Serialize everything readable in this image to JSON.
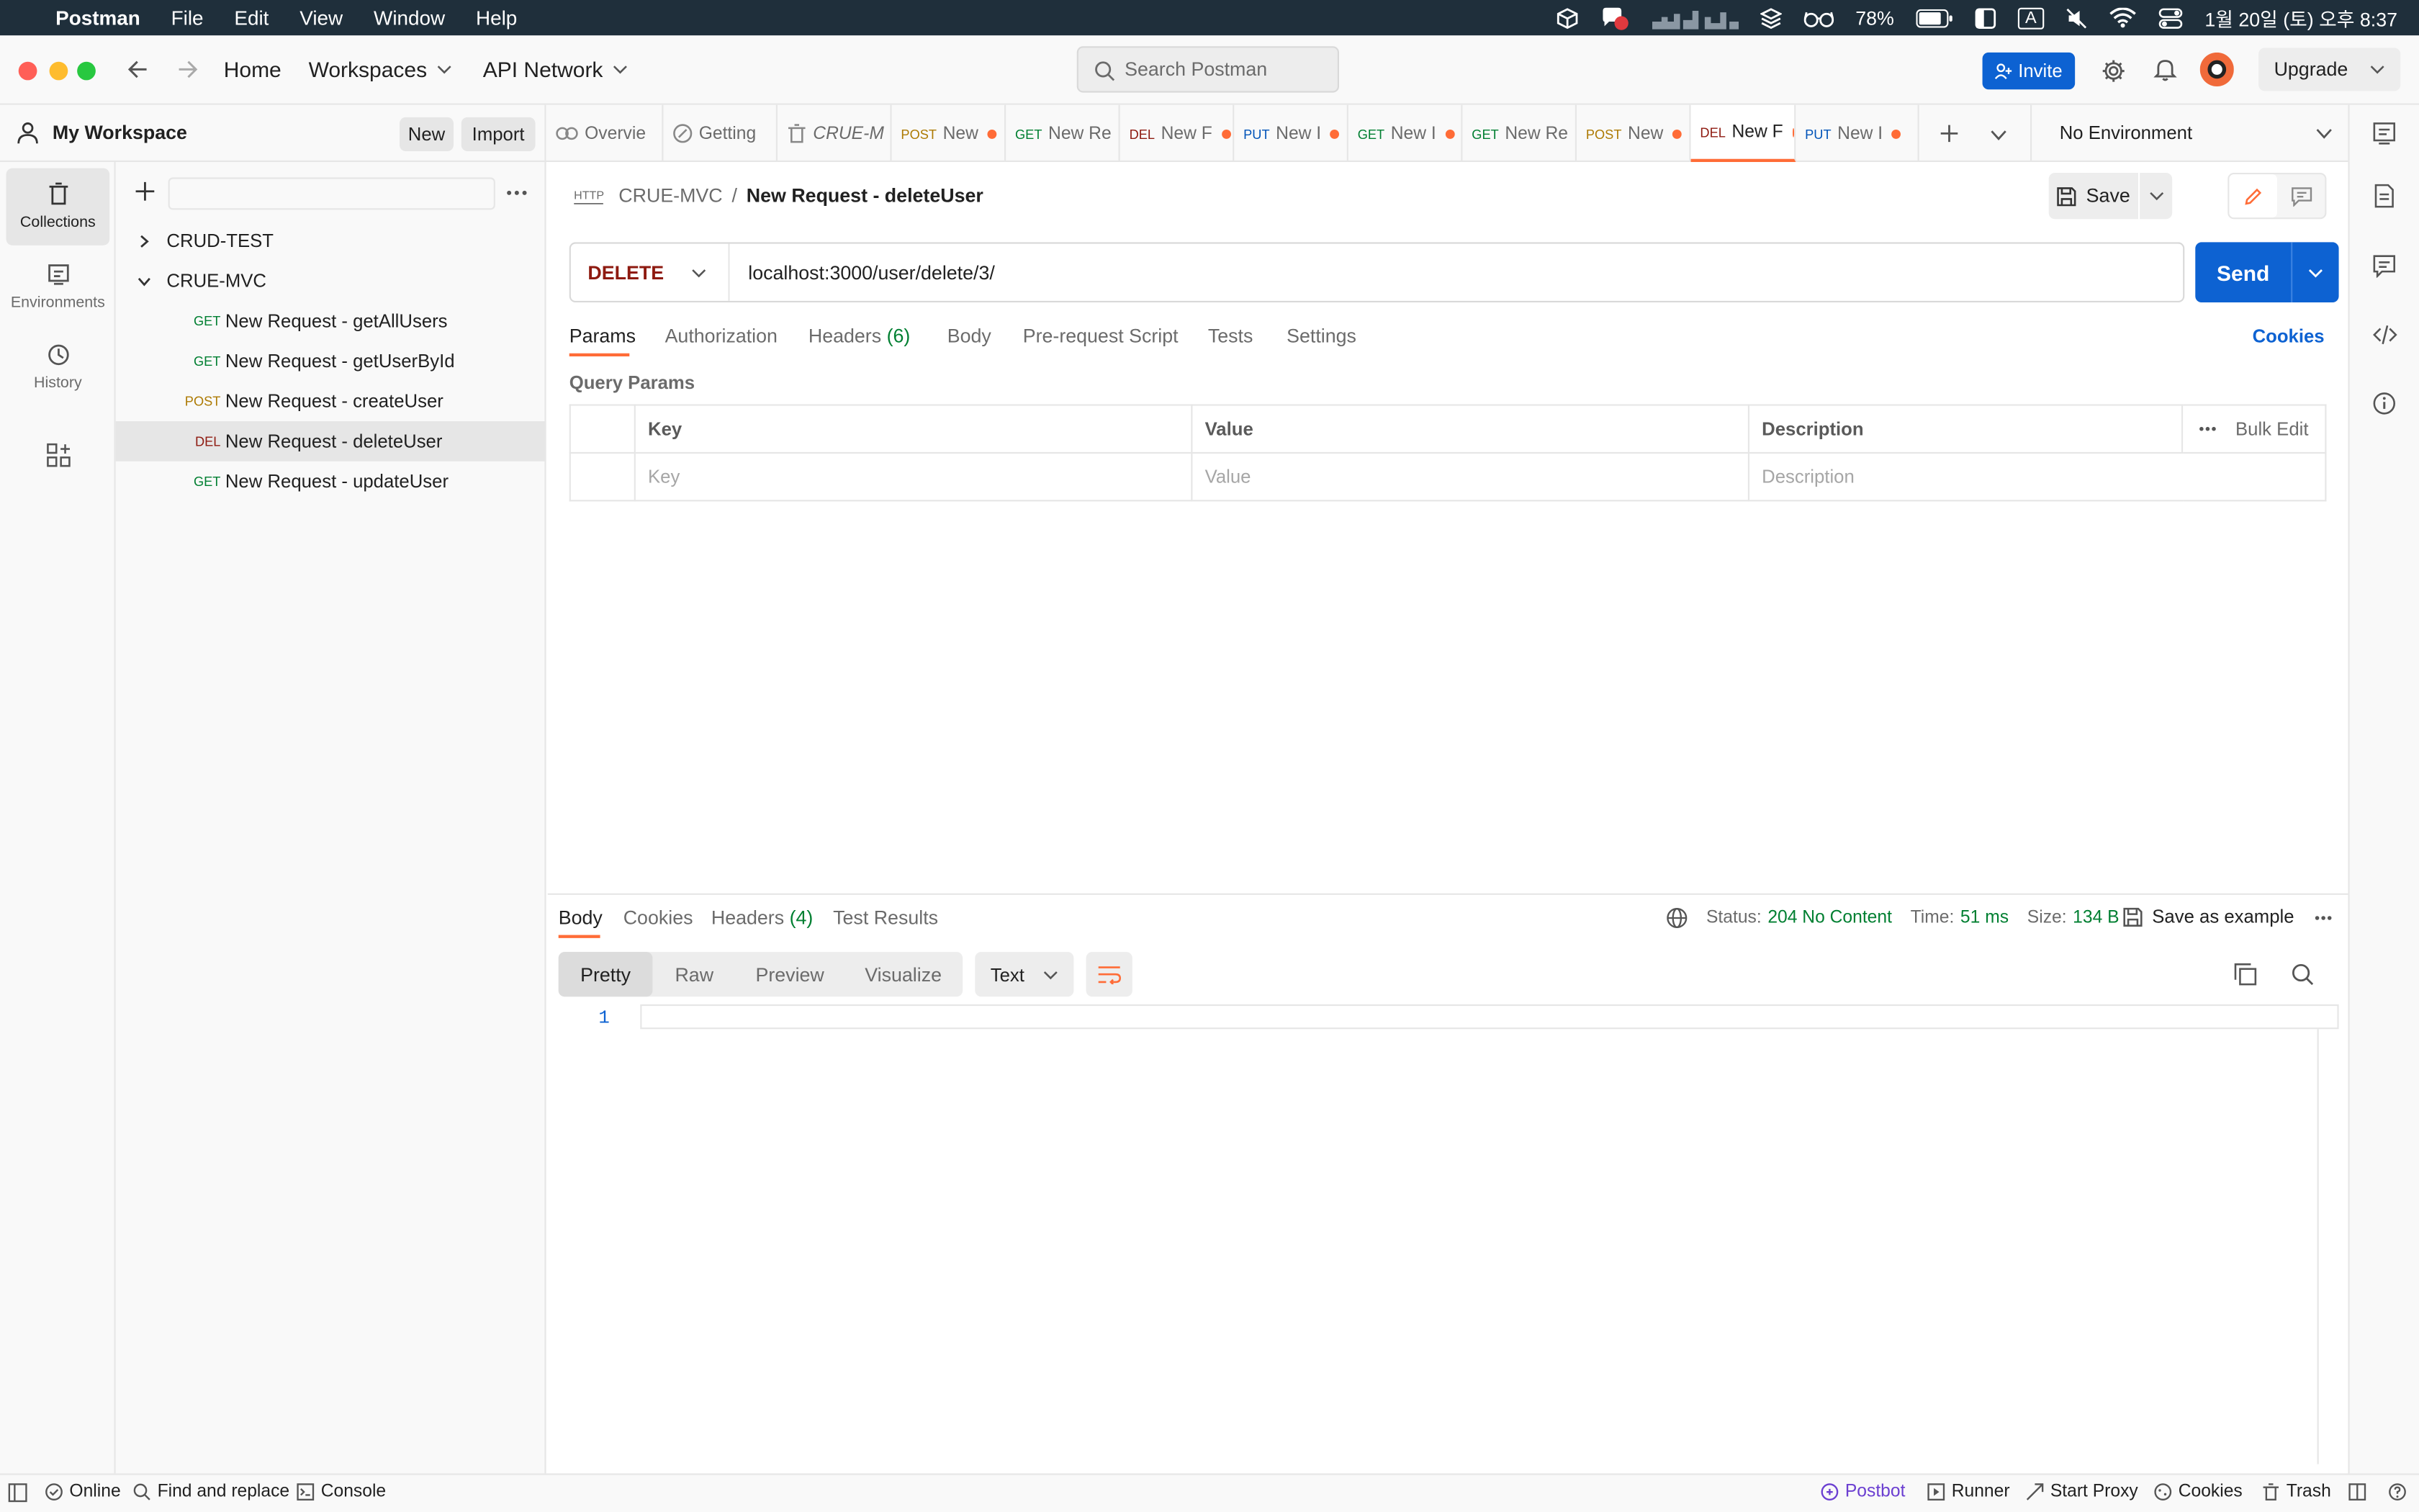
{
  "menubar": {
    "app": "Postman",
    "menus": [
      "File",
      "Edit",
      "View",
      "Window",
      "Help"
    ],
    "battery": "78%",
    "input_mode": "A",
    "datetime": "1월 20일 (토) 오후 8:37"
  },
  "titlebar": {
    "home": "Home",
    "workspaces": "Workspaces",
    "api_network": "API Network",
    "search_placeholder": "Search Postman",
    "invite": "Invite",
    "upgrade": "Upgrade"
  },
  "workspace": {
    "name": "My Workspace",
    "new_label": "New",
    "import_label": "Import"
  },
  "rail": {
    "collections": "Collections",
    "environments": "Environments",
    "history": "History"
  },
  "tree": {
    "collections": [
      {
        "name": "CRUD-TEST",
        "expanded": false
      },
      {
        "name": "CRUE-MVC",
        "expanded": true
      }
    ],
    "requests": [
      {
        "method": "GET",
        "name": "New Request - getAllUsers",
        "color": "#007f31"
      },
      {
        "method": "GET",
        "name": "New Request - getUserById",
        "color": "#007f31"
      },
      {
        "method": "POST",
        "name": "New Request - createUser",
        "color": "#ad7a03"
      },
      {
        "method": "DEL",
        "name": "New Request - deleteUser",
        "color": "#8e1a10"
      },
      {
        "method": "GET",
        "name": "New Request - updateUser",
        "color": "#007f31"
      }
    ]
  },
  "tabs": [
    {
      "method": "",
      "label": "Overvie",
      "dot": false
    },
    {
      "method": "",
      "label": "Getting",
      "dot": false
    },
    {
      "method": "",
      "label": "CRUE-M",
      "dot": false
    },
    {
      "method": "POST",
      "label": "New",
      "dot": true,
      "color": "#ad7a03"
    },
    {
      "method": "GET",
      "label": "New Re",
      "dot": false,
      "color": "#007f31"
    },
    {
      "method": "DEL",
      "label": "New F",
      "dot": true,
      "color": "#8e1a10"
    },
    {
      "method": "PUT",
      "label": "New I",
      "dot": true,
      "color": "#0053b8"
    },
    {
      "method": "GET",
      "label": "New I",
      "dot": true,
      "color": "#007f31"
    },
    {
      "method": "GET",
      "label": "New Re",
      "dot": false,
      "color": "#007f31"
    },
    {
      "method": "POST",
      "label": "New",
      "dot": true,
      "color": "#ad7a03"
    },
    {
      "method": "DEL",
      "label": "New F",
      "dot": true,
      "color": "#8e1a10",
      "active": true
    },
    {
      "method": "PUT",
      "label": "New I",
      "dot": true,
      "color": "#0053b8"
    }
  ],
  "environment": "No Environment",
  "request": {
    "breadcrumb_collection": "CRUE-MVC",
    "breadcrumb_sep": "/",
    "title": "New Request - deleteUser",
    "save": "Save",
    "method": "DELETE",
    "url": "localhost:3000/user/delete/3/",
    "send": "Send",
    "subtabs": {
      "params": "Params",
      "authorization": "Authorization",
      "headers": "Headers",
      "headers_count": "(6)",
      "body": "Body",
      "prerequest": "Pre-request Script",
      "tests": "Tests",
      "settings": "Settings"
    },
    "cookies": "Cookies",
    "query_params_title": "Query Params",
    "table": {
      "key": "Key",
      "value": "Value",
      "description": "Description",
      "bulk_edit": "Bulk Edit",
      "key_placeholder": "Key",
      "value_placeholder": "Value",
      "description_placeholder": "Description"
    }
  },
  "response": {
    "tabs": {
      "body": "Body",
      "cookies": "Cookies",
      "headers": "Headers",
      "headers_count": "(4)",
      "test_results": "Test Results"
    },
    "status_label": "Status:",
    "status_value": "204 No Content",
    "time_label": "Time:",
    "time_value": "51 ms",
    "size_label": "Size:",
    "size_value": "134 B",
    "save_example": "Save as example",
    "views": [
      "Pretty",
      "Raw",
      "Preview",
      "Visualize"
    ],
    "format": "Text",
    "line_number": "1"
  },
  "bottombar": {
    "online": "Online",
    "find_replace": "Find and replace",
    "console": "Console",
    "postbot": "Postbot",
    "runner": "Runner",
    "start_proxy": "Start Proxy",
    "cookies": "Cookies",
    "trash": "Trash"
  }
}
